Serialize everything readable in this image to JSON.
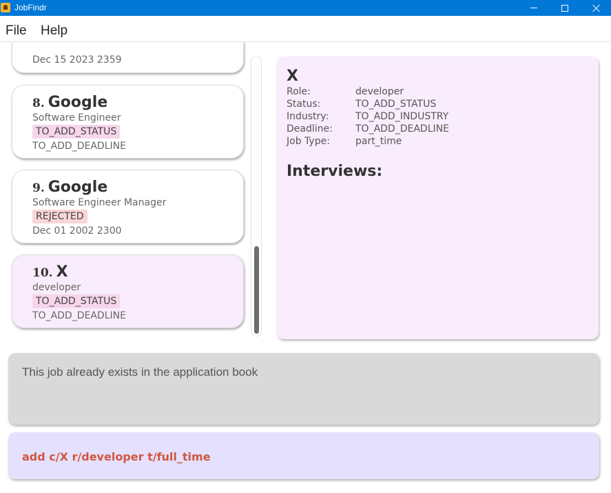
{
  "window": {
    "title": "JobFindr"
  },
  "menu": {
    "file": "File",
    "help": "Help"
  },
  "job_list": {
    "partial_card": {
      "deadline": "Dec 15 2023 2359"
    },
    "cards": [
      {
        "index": "8.",
        "company": "Google",
        "role": "Software Engineer",
        "status": "TO_ADD_STATUS",
        "deadline": "TO_ADD_DEADLINE",
        "selected": false
      },
      {
        "index": "9.",
        "company": "Google",
        "role": "Software Engineer Manager",
        "status": "REJECTED",
        "deadline": "Dec 01 2002 2300",
        "selected": false
      },
      {
        "index": "10.",
        "company": "X",
        "role": "developer",
        "status": "TO_ADD_STATUS",
        "deadline": "TO_ADD_DEADLINE",
        "selected": true
      }
    ],
    "scroll_position": 0.85
  },
  "detail": {
    "company": "X",
    "fields": [
      {
        "label": "Role:",
        "value": "developer"
      },
      {
        "label": "Status:",
        "value": "TO_ADD_STATUS"
      },
      {
        "label": "Industry:",
        "value": "TO_ADD_INDUSTRY"
      },
      {
        "label": "Deadline:",
        "value": "TO_ADD_DEADLINE"
      },
      {
        "label": "Job Type:",
        "value": "part_time"
      }
    ],
    "interviews_heading": "Interviews:"
  },
  "result": {
    "message": "This job already exists in the application book"
  },
  "command": {
    "value": "add c/X r/developer t/full_time"
  },
  "colors": {
    "titlebar": "#0078d7",
    "selected_card": "#f9ecfc",
    "status_todo": "#f6d6ea",
    "status_rejected": "#f9d5d5",
    "result_box": "#d9d9d9",
    "command_box": "#e5e0fd",
    "command_text": "#d0573f"
  }
}
